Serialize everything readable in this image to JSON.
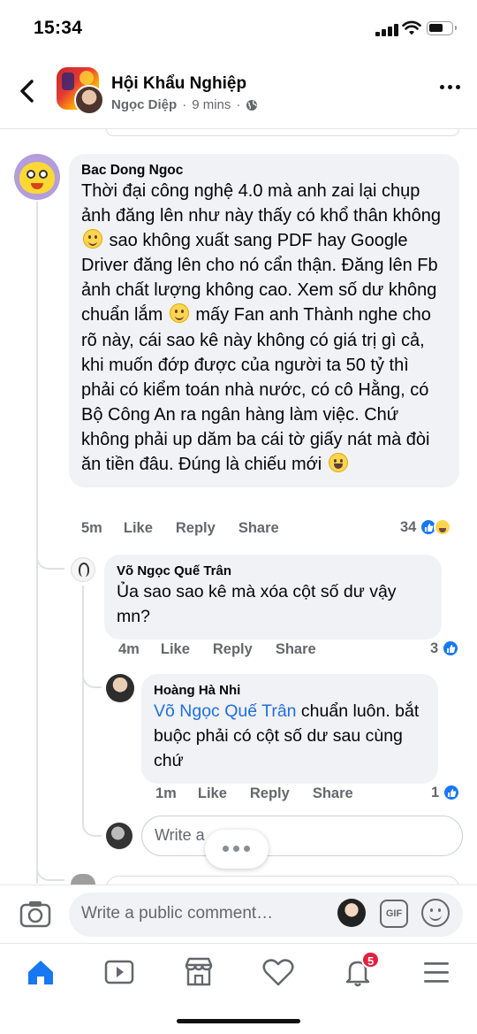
{
  "status_bar": {
    "time": "15:34"
  },
  "header": {
    "group_name": "Hội Khẩu Nghiệp",
    "author": "Ngọc Diệp",
    "separator": "·",
    "time": "9 mins",
    "separator2": "·"
  },
  "comments": [
    {
      "author": "Bac Dong Ngoc",
      "segments": [
        "Thời đại công nghệ 4.0 mà anh zai lại chụp ảnh đăng lên như này thấy có khổ thân không ",
        " sao không xuất sang PDF hay Google Driver đăng lên cho nó cẩn thận. Đăng lên Fb ảnh chất lượng không cao. Xem số dư không chuẩn lắm ",
        " mấy Fan anh Thành nghe cho rõ này, cái sao kê này không có giá trị gì cả, khi muốn đớp được của người ta 50 tỷ thì phải có kiểm toán nhà nước, có cô Hằng, có Bộ Công An ra ngân hàng làm việc. Chứ không phải up dăm ba cái tờ giấy nát mà đòi ăn tiền đâu. Đúng là chiếu mới "
      ],
      "time": "5m",
      "like": "Like",
      "reply": "Reply",
      "share": "Share",
      "reaction_count": "34"
    },
    {
      "author": "Võ Ngọc Quế Trân",
      "text": "Ủa sao sao kê mà xóa cột số dư vậy mn?",
      "time": "4m",
      "like": "Like",
      "reply": "Reply",
      "share": "Share",
      "reaction_count": "3"
    },
    {
      "author": "Hoàng Hà Nhi",
      "mention": "Võ Ngọc Quế Trân",
      "text": " chuẩn luôn. bắt buộc phải có cột số dư sau cùng chứ",
      "time": "1m",
      "like": "Like",
      "reply": "Reply",
      "share": "Share",
      "reaction_count": "1"
    }
  ],
  "reply_box": {
    "placeholder": "Write a"
  },
  "composer": {
    "placeholder": "Write a public comment…",
    "gif_label": "GIF"
  },
  "tabbar": {
    "notifications_badge": "5"
  },
  "colors": {
    "accent": "#1877f2",
    "badge": "#e41e3f",
    "bubble": "#f0f2f5",
    "mention": "#216fdb"
  }
}
